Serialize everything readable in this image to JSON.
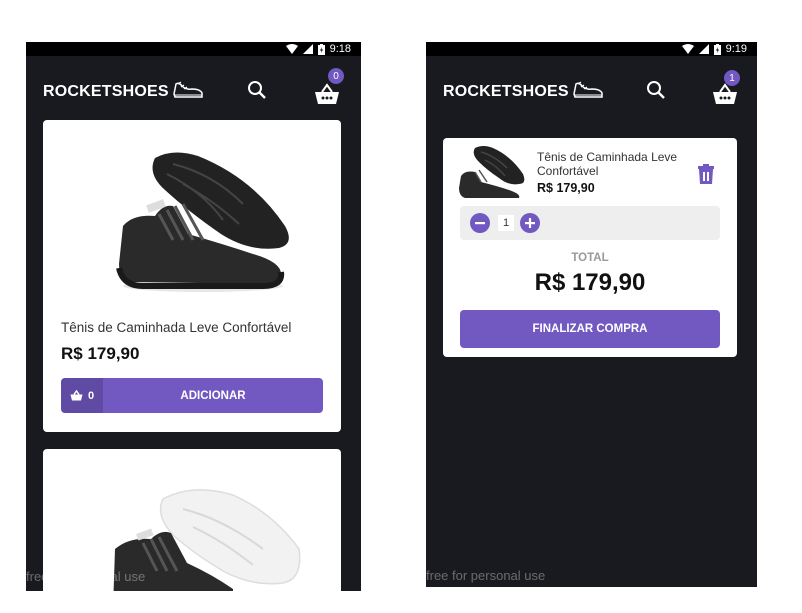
{
  "left_screen": {
    "status_bar": {
      "time": "9:18"
    },
    "header": {
      "logo_text": "ROCKETSHOES",
      "cart_count": "0"
    },
    "products": [
      {
        "title": "Tênis de Caminhada Leve Confortável",
        "price": "R$ 179,90",
        "amount_in_cart": "0",
        "add_button_label": "ADICIONAR"
      }
    ],
    "watermark": "free for personal use"
  },
  "right_screen": {
    "status_bar": {
      "time": "9:19"
    },
    "header": {
      "logo_text": "ROCKETSHOES",
      "cart_count": "1"
    },
    "cart": {
      "item": {
        "title": "Tênis de Caminhada Leve Confortável",
        "price": "R$ 179,90",
        "quantity": "1"
      },
      "total_label": "TOTAL",
      "total_value": "R$ 179,90",
      "checkout_label": "FINALIZAR COMPRA"
    },
    "watermark": "free for personal use"
  },
  "colors": {
    "primary": "#7159c1",
    "background": "#191920",
    "card": "#ffffff"
  }
}
